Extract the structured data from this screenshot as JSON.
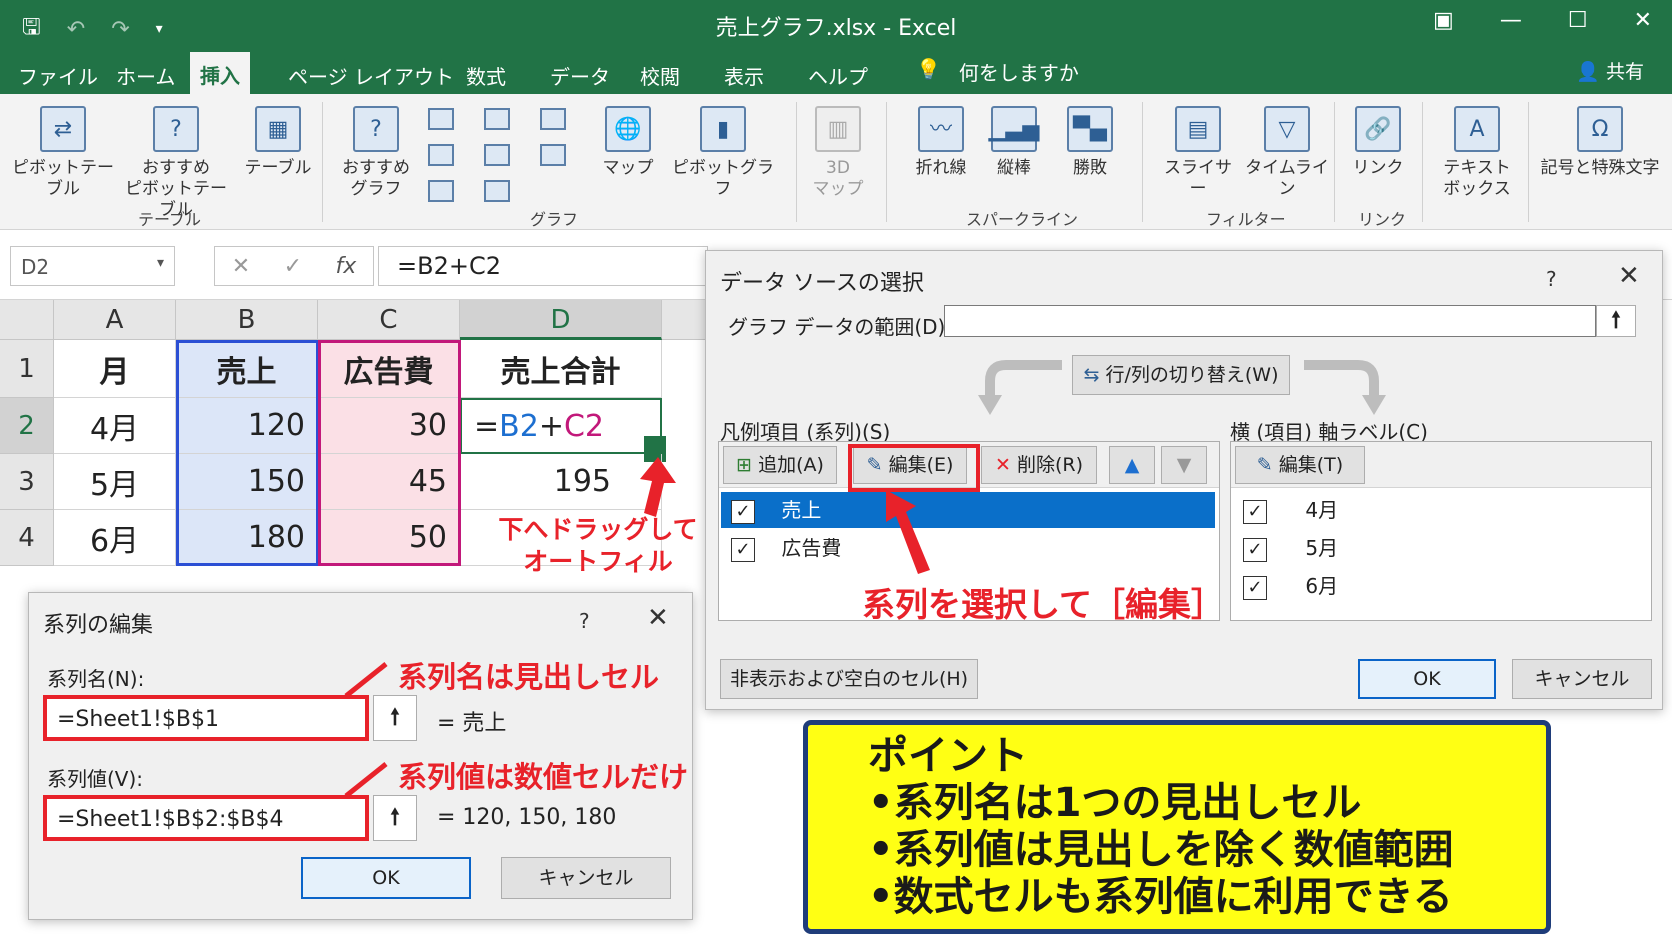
{
  "titlebar": {
    "title": "売上グラフ.xlsx  -  Excel"
  },
  "tabs": [
    {
      "label": "ファイル"
    },
    {
      "label": "ホーム"
    },
    {
      "label": "挿入"
    },
    {
      "label": "ページ レイアウト"
    },
    {
      "label": "数式"
    },
    {
      "label": "データ"
    },
    {
      "label": "校閲"
    },
    {
      "label": "表示"
    },
    {
      "label": "ヘルプ"
    }
  ],
  "tellme": "何をしますか",
  "share": "共有",
  "ribbon": {
    "pivot": "ピボットテーブル",
    "rec_pivot_1": "おすすめ",
    "rec_pivot_2": "ピボットテーブル",
    "table": "テーブル",
    "group_table": "テーブル",
    "rec_chart_1": "おすすめ",
    "rec_chart_2": "グラフ",
    "map": "マップ",
    "pivotchart": "ピボットグラフ",
    "group_chart": "グラフ",
    "map3d_1": "3D",
    "map3d_2": "マップ",
    "line": "折れ線",
    "column": "縦棒",
    "winloss": "勝敗",
    "group_spark": "スパークライン",
    "slicer": "スライサー",
    "timeline": "タイムライン",
    "group_filter": "フィルター",
    "link": "リンク",
    "group_link": "リンク",
    "textbox_1": "テキスト",
    "textbox_2": "ボックス",
    "symbol": "記号と特殊文字"
  },
  "formulabar": {
    "namebox": "D2",
    "fx": "fx",
    "formula": "=B2+C2"
  },
  "grid": {
    "cols": [
      "A",
      "B",
      "C",
      "D"
    ],
    "rows": [
      "1",
      "2",
      "3",
      "4"
    ],
    "headers": [
      "月",
      "売上",
      "広告費",
      "売上合計"
    ],
    "data": [
      [
        "4月",
        "120",
        "30",
        ""
      ],
      [
        "5月",
        "150",
        "45",
        "195"
      ],
      [
        "6月",
        "180",
        "50",
        ""
      ]
    ],
    "d2_prefix": "=",
    "d2_b": "B2",
    "d2_plus": "+",
    "d2_c": "C2"
  },
  "annotations": {
    "drag_1": "下へドラッグして",
    "drag_2": "オートフィル",
    "select_edit": "系列を選択して［編集］",
    "name_note": "系列名は見出しセル",
    "value_note": "系列値は数値セルだけ"
  },
  "datasource": {
    "title": "データ ソースの選択",
    "help": "?",
    "range_label": "グラフ データの範囲(D):",
    "switch": "行/列の切り替え(W)",
    "legend_label": "凡例項目 (系列)(S)",
    "add": "追加(A)",
    "edit": "編集(E)",
    "delete": "削除(R)",
    "series": [
      {
        "name": "売上"
      },
      {
        "name": "広告費"
      }
    ],
    "axis_label": "横 (項目) 軸ラベル(C)",
    "axis_edit": "編集(T)",
    "categories": [
      "4月",
      "5月",
      "6月"
    ],
    "hidden": "非表示および空白のセル(H)",
    "ok": "OK",
    "cancel": "キャンセル"
  },
  "editseries": {
    "title": "系列の編集",
    "help": "?",
    "name_label": "系列名(N):",
    "name_value": "=Sheet1!$B$1",
    "name_result": "= 売上",
    "values_label": "系列値(V):",
    "values_value": "=Sheet1!$B$2:$B$4",
    "values_result": "= 120, 150, 180",
    "ok": "OK",
    "cancel": "キャンセル"
  },
  "point": {
    "title": "ポイント",
    "items": [
      "•系列名は1つの見出しセル",
      "•系列値は見出しを除く数値範囲",
      "•数式セルも系列値に利用できる"
    ]
  },
  "colors": {
    "excel_green": "#217346",
    "annotation_red": "#e8222a",
    "point_yellow": "#ffff14",
    "point_border": "#1f3d7a",
    "select_blue": "#0a6fc9"
  }
}
